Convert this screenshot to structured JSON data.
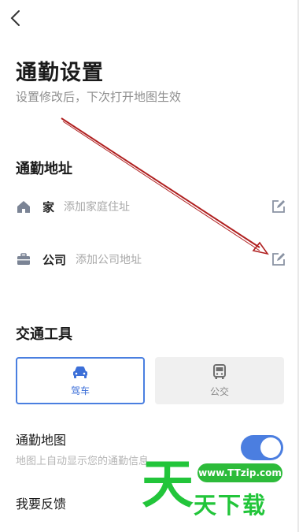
{
  "header": {
    "back_icon": "chevron-left-icon"
  },
  "page": {
    "title": "通勤设置",
    "subtitle": "设置修改后，下次打开地图生效"
  },
  "address_section": {
    "title": "通勤地址",
    "items": [
      {
        "icon": "home-icon",
        "label": "家",
        "placeholder": "添加家庭住址",
        "edit_icon": "edit-icon"
      },
      {
        "icon": "briefcase-icon",
        "label": "公司",
        "placeholder": "添加公司地址",
        "edit_icon": "edit-icon"
      }
    ]
  },
  "transport_section": {
    "title": "交通工具",
    "options": [
      {
        "icon": "car-icon",
        "label": "驾车",
        "selected": true
      },
      {
        "icon": "bus-icon",
        "label": "公交",
        "selected": false
      }
    ]
  },
  "commute_map": {
    "title": "通勤地图",
    "description": "地图上自动显示您的通勤信息",
    "enabled": true
  },
  "feedback": {
    "label": "我要反馈"
  },
  "watermark": {
    "url": "www.TTzip.com",
    "big_char": "天",
    "text": "天下载"
  },
  "colors": {
    "accent": "#4b7ee0",
    "arrow": "#b02020",
    "watermark": "#22c53a"
  }
}
